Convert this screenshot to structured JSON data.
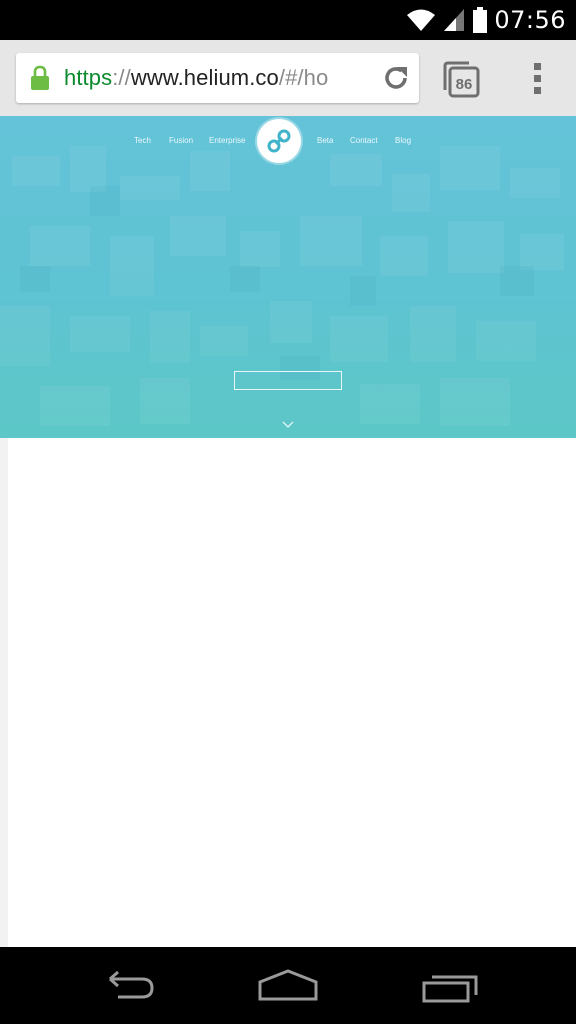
{
  "status_bar": {
    "time": "07:56",
    "icons": [
      "wifi-icon",
      "signal-icon",
      "battery-icon"
    ]
  },
  "browser": {
    "url": {
      "scheme": "https",
      "separator": "://",
      "host": "www.helium.co",
      "path": "/#/ho"
    },
    "tab_count": "86",
    "icons": [
      "lock-icon",
      "reload-icon",
      "tabs-icon",
      "overflow-menu-icon"
    ]
  },
  "page": {
    "nav_left": [
      "Tech",
      "Fusion",
      "Enterprise"
    ],
    "nav_right": [
      "Beta",
      "Contact",
      "Blog"
    ],
    "logo": "helium-logo-icon",
    "hero_input_value": "",
    "colors": {
      "hero_top": "#64c3d8",
      "hero_bottom": "#5cc7c6",
      "url_scheme": "#0b8a2e"
    }
  },
  "system_nav": {
    "buttons": [
      "back-icon",
      "home-icon",
      "recents-icon"
    ]
  }
}
